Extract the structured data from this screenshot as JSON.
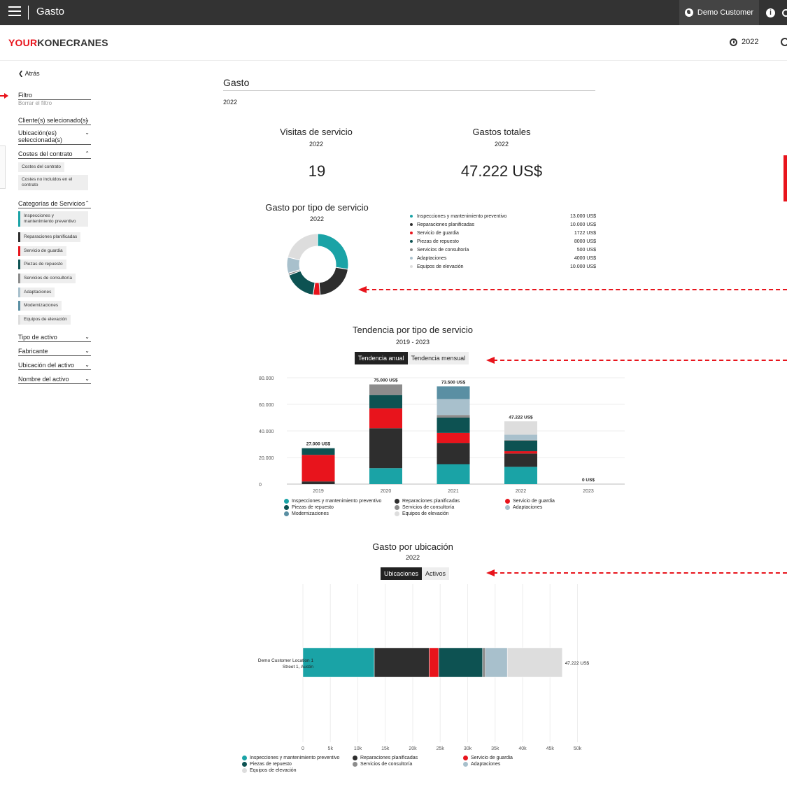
{
  "app": {
    "title": "Gasto",
    "customer": "Demo Customer",
    "year": "2022"
  },
  "brand": {
    "your": "YOUR",
    "rest": "KONECRANES"
  },
  "sidebar": {
    "back": "Atrás",
    "filter": "Filtro",
    "clear": "Borrar el filtro",
    "clients": "Cliente(s) selecionado(s)",
    "locations": "Ubicación(es) seleccionada(s)",
    "contract_costs": "Costes del contrato",
    "contract_chip_1": "Costes del contrato",
    "contract_chip_2": "Costes no incluidos en el contrato",
    "service_categories": "Categorías de Servicios",
    "categories": [
      {
        "label": "Inspecciones y mantenimiento preventivo",
        "color": "#1aa3a6"
      },
      {
        "label": "Reparaciones planificadas",
        "color": "#2e2e2e"
      },
      {
        "label": "Servicio de guardia",
        "color": "#e8141c"
      },
      {
        "label": "Piezas de repuesto",
        "color": "#0d5252"
      },
      {
        "label": "Servicios de consultoría",
        "color": "#8c8c8c"
      },
      {
        "label": "Adaptaciones",
        "color": "#a8c0cc"
      },
      {
        "label": "Modernizaciones",
        "color": "#5a8fa3"
      },
      {
        "label": "Equipos de elevación",
        "color": "#dddddd"
      }
    ],
    "asset_type": "Tipo de activo",
    "manufacturer": "Fabricante",
    "asset_location": "Ubicación del activo",
    "asset_name": "Nombre del activo"
  },
  "main": {
    "title": "Gasto",
    "year": "2022",
    "kpis": [
      {
        "title": "Visitas de servicio",
        "year": "2022",
        "value": "19"
      },
      {
        "title": "Gastos totales",
        "year": "2022",
        "value": "47.222 US$"
      }
    ],
    "donut": {
      "title": "Gasto por tipo de servicio",
      "year": "2022"
    },
    "trend": {
      "title": "Tendencia por tipo de servicio",
      "years": "2019 - 2023",
      "tab_annual": "Tendencia anual",
      "tab_monthly": "Tendencia mensual"
    },
    "location": {
      "title": "Gasto por ubicación",
      "year": "2022",
      "tab_locations": "Ubicaciones",
      "tab_assets": "Activos"
    }
  },
  "chart_data": [
    {
      "type": "pie",
      "title": "Gasto por tipo de servicio",
      "categories": [
        "Inspecciones y mantenimiento preventivo",
        "Reparaciones planificadas",
        "Servicio de guardia",
        "Piezas de repuesto",
        "Servicios de consultoría",
        "Adaptaciones",
        "Equipos de elevación"
      ],
      "values": [
        13000,
        10000,
        1722,
        8000,
        500,
        4000,
        10000
      ],
      "labels": [
        "13.000 US$",
        "10.000 US$",
        "1722 US$",
        "8000 US$",
        "500 US$",
        "4000 US$",
        "10.000 US$"
      ],
      "colors": [
        "#1aa3a6",
        "#2e2e2e",
        "#e8141c",
        "#0d5252",
        "#8c8c8c",
        "#a8c0cc",
        "#dddddd"
      ]
    },
    {
      "type": "bar",
      "title": "Tendencia por tipo de servicio",
      "categories": [
        "2019",
        "2020",
        "2021",
        "2022",
        "2023"
      ],
      "ylim": [
        0,
        80000
      ],
      "yticks": [
        "0",
        "20.000",
        "40.000",
        "60.000",
        "80.000"
      ],
      "totals": [
        "27.000 US$",
        "75.000 US$",
        "73.500 US$",
        "47.222 US$",
        "0 US$"
      ],
      "series": [
        {
          "name": "Inspecciones y mantenimiento preventivo",
          "color": "#1aa3a6",
          "values": [
            0,
            12000,
            15000,
            13000,
            0
          ]
        },
        {
          "name": "Reparaciones planificadas",
          "color": "#2e2e2e",
          "values": [
            2000,
            30000,
            16000,
            10000,
            0
          ]
        },
        {
          "name": "Servicio de guardia",
          "color": "#e8141c",
          "values": [
            20000,
            15000,
            7500,
            1722,
            0
          ]
        },
        {
          "name": "Piezas de repuesto",
          "color": "#0d5252",
          "values": [
            5000,
            10000,
            11500,
            8000,
            0
          ]
        },
        {
          "name": "Servicios de consultoría",
          "color": "#8c8c8c",
          "values": [
            0,
            8000,
            2000,
            500,
            0
          ]
        },
        {
          "name": "Adaptaciones",
          "color": "#a8c0cc",
          "values": [
            0,
            0,
            12000,
            4000,
            0
          ]
        },
        {
          "name": "Modernizaciones",
          "color": "#5a8fa3",
          "values": [
            0,
            0,
            9500,
            0,
            0
          ]
        },
        {
          "name": "Equipos de elevación",
          "color": "#dddddd",
          "values": [
            0,
            0,
            0,
            10000,
            0
          ]
        }
      ]
    },
    {
      "type": "bar",
      "title": "Gasto por ubicación",
      "orientation": "horizontal",
      "location_name": "Demo Customer Location 1",
      "location_address": "Street 1, Austin",
      "total": "47.222 US$",
      "xlim": [
        0,
        50000
      ],
      "xticks": [
        "0",
        "5k",
        "10k",
        "15k",
        "20k",
        "25k",
        "30k",
        "35k",
        "40k",
        "45k",
        "50k"
      ],
      "series": [
        {
          "name": "Inspecciones y mantenimiento preventivo",
          "color": "#1aa3a6",
          "value": 13000
        },
        {
          "name": "Reparaciones planificadas",
          "color": "#2e2e2e",
          "value": 10000
        },
        {
          "name": "Servicio de guardia",
          "color": "#e8141c",
          "value": 1722
        },
        {
          "name": "Piezas de repuesto",
          "color": "#0d5252",
          "value": 8000
        },
        {
          "name": "Servicios de consultoría",
          "color": "#8c8c8c",
          "value": 500
        },
        {
          "name": "Adaptaciones",
          "color": "#a8c0cc",
          "value": 4000
        },
        {
          "name": "Equipos de elevación",
          "color": "#dddddd",
          "value": 10000
        }
      ]
    }
  ]
}
